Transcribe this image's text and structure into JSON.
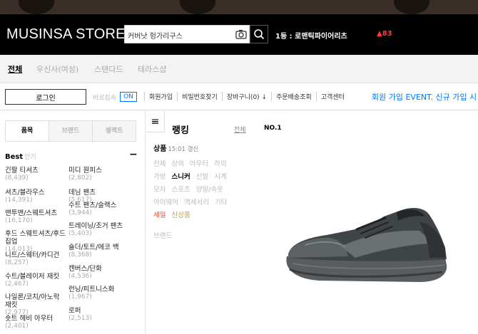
{
  "header": {
    "logo": "MUSINSA STORE",
    "search_value": "커버낫 헝가리구스",
    "ranking_text": "1등 : 로맨틱파이어리츠",
    "ranking_change": "▲83"
  },
  "category_tabs": [
    {
      "label": "전체",
      "active": true
    },
    {
      "label": "우신사(여성)",
      "active": false
    },
    {
      "label": "스탠다드",
      "active": false
    },
    {
      "label": "테라스샵",
      "active": false
    }
  ],
  "util": {
    "login": "로그인",
    "quick_label": "바로접속",
    "quick_toggle": "ON",
    "links": [
      "회원가입",
      "비밀번호찾기",
      "장바구니(0) ↓",
      "주문배송조회",
      "고객센터"
    ],
    "event": "회원 가입 EVENT. 신규 가입 시"
  },
  "sidebar": {
    "tabs": [
      {
        "label": "품목",
        "active": true
      },
      {
        "label": "브랜드",
        "active": false
      },
      {
        "label": "셀렉트",
        "active": false
      }
    ],
    "best_title": "Best",
    "best_sub": "인기",
    "collapse": "−",
    "left_items": [
      {
        "label": "긴팔 티셔츠",
        "count": "(8,439)"
      },
      {
        "label": "셔츠/블라우스",
        "count": "(14,391)"
      },
      {
        "label": "맨투맨/스웨트셔츠",
        "count": "(16,170)"
      },
      {
        "label": "후드 스웨트셔츠/후드 집업",
        "count": "(14,013)"
      },
      {
        "label": "니트/스웨터/카디건",
        "count": "(8,257)"
      },
      {
        "label": "수트/블레이저 재킷",
        "count": "(2,467)"
      },
      {
        "label": "나일론/코치/아노락 재킷",
        "count": "(2,977)"
      },
      {
        "label": "숏트 헤비 아우터",
        "count": "(2,401)"
      }
    ],
    "right_items": [
      {
        "label": "미디 원피스",
        "count": "(2,802)"
      },
      {
        "label": "데님 팬츠",
        "count": "(5,617)"
      },
      {
        "label": "수트 팬츠/슬랙스",
        "count": "(3,944)"
      },
      {
        "label": "트레이닝/조거 팬츠",
        "count": "(5,403)"
      },
      {
        "label": "숄더/토트/에코 백",
        "count": "(8,368)"
      },
      {
        "label": "캔버스/단화",
        "count": "(4,536)"
      },
      {
        "label": "런닝/피트니스화",
        "count": "(1,967)"
      },
      {
        "label": "로퍼",
        "count": "(2,513)"
      }
    ]
  },
  "main": {
    "menu_icon": "≡",
    "title": "랭킹",
    "tab_all": "전체",
    "rank_no": "NO.1",
    "product_title": "상품",
    "product_time": "15:01 갱신",
    "filter_rows": [
      [
        {
          "label": "전체"
        },
        {
          "label": "상의"
        },
        {
          "label": "아우터"
        },
        {
          "label": "하의"
        }
      ],
      [
        {
          "label": "가방"
        },
        {
          "label": "스니커",
          "state": "on"
        },
        {
          "label": "신발"
        },
        {
          "label": "시계"
        }
      ],
      [
        {
          "label": "모자"
        },
        {
          "label": "스포츠"
        },
        {
          "label": "양말/속옷"
        }
      ],
      [
        {
          "label": "아이웨어"
        },
        {
          "label": "액세서리"
        },
        {
          "label": "기타"
        }
      ],
      [
        {
          "label": "세일",
          "state": "red"
        },
        {
          "label": "신상품",
          "state": "gold"
        }
      ]
    ],
    "brand_label": "브랜드"
  },
  "colors": {
    "header_bg": "#000000",
    "accent_blue": "#0078ff",
    "rank_red": "#ff3b3b"
  }
}
